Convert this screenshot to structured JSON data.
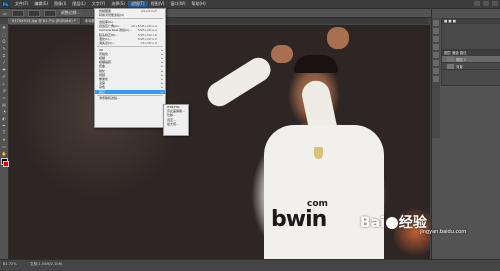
{
  "menubar": {
    "logo": "Ps",
    "items": [
      "文件(F)",
      "编辑(E)",
      "图像(I)",
      "图层(L)",
      "文字(Y)",
      "选择(S)",
      "滤镜(T)",
      "视图(V)",
      "窗口(W)",
      "帮助(H)"
    ]
  },
  "optionsbar": {
    "items": [
      "调整边缘...",
      "宽度:",
      "高度:",
      "调整边缘..."
    ]
  },
  "tabs": [
    {
      "label": "0370X515.jpg @ 81.7% (RGB/8#) *"
    },
    {
      "label": "未标题-1 @ ..."
    }
  ],
  "dropdown": {
    "items": [
      {
        "label": "仿制图章",
        "shortcut": "Alt+Ctrl+F"
      },
      {
        "label": "转换为智能滤镜(S)",
        "shortcut": ""
      },
      {
        "sep": true
      },
      {
        "label": "滤镜库(G)...",
        "shortcut": ""
      },
      {
        "label": "自适应广角(A)...",
        "shortcut": "Alt+Shift+Ctrl+A"
      },
      {
        "label": "Camera Raw 滤镜(C)...",
        "shortcut": "Shift+Ctrl+A"
      },
      {
        "label": "镜头校正(R)...",
        "shortcut": "Shift+Ctrl+R"
      },
      {
        "label": "液化(L)...",
        "shortcut": "Shift+Ctrl+X"
      },
      {
        "label": "消失点(V)...",
        "shortcut": "Alt+Ctrl+V"
      },
      {
        "sep": true
      },
      {
        "label": "3D",
        "shortcut": "",
        "sub": true
      },
      {
        "label": "风格化",
        "shortcut": "",
        "sub": true
      },
      {
        "label": "模糊",
        "shortcut": "",
        "sub": true
      },
      {
        "label": "模糊画廊",
        "shortcut": "",
        "sub": true
      },
      {
        "label": "扭曲",
        "shortcut": "",
        "sub": true
      },
      {
        "label": "锐化",
        "shortcut": "",
        "sub": true
      },
      {
        "label": "视频",
        "shortcut": "",
        "sub": true
      },
      {
        "label": "像素化",
        "shortcut": "",
        "sub": true
      },
      {
        "label": "渲染",
        "shortcut": "",
        "sub": true
      },
      {
        "label": "杂色",
        "shortcut": "",
        "sub": true
      },
      {
        "label": "其它",
        "shortcut": "",
        "sub": true,
        "highlight": true
      },
      {
        "sep": true
      },
      {
        "label": "浏览联机滤镜...",
        "shortcut": ""
      }
    ]
  },
  "submenu": {
    "items": [
      "HSB/HSL",
      "高反差保留...",
      "位移...",
      "自定...",
      "最大值..."
    ]
  },
  "rpanel": {
    "tabs": [
      "图层",
      "通道",
      "路径"
    ],
    "layers": [
      "图层 1",
      "背景"
    ]
  },
  "statusbar": {
    "zoom": "81.72%",
    "doc": "文档:1.05M/2.10M"
  },
  "watermark": {
    "brand_left": "Bai",
    "brand_right": "经验",
    "url": "jingyan.baidu.com"
  },
  "photo": {
    "sponsor_top": "com",
    "sponsor": "bwin"
  },
  "colors": {
    "menu_highlight": "#3399ff",
    "foreground": "#000000",
    "background": "#dd0000"
  }
}
